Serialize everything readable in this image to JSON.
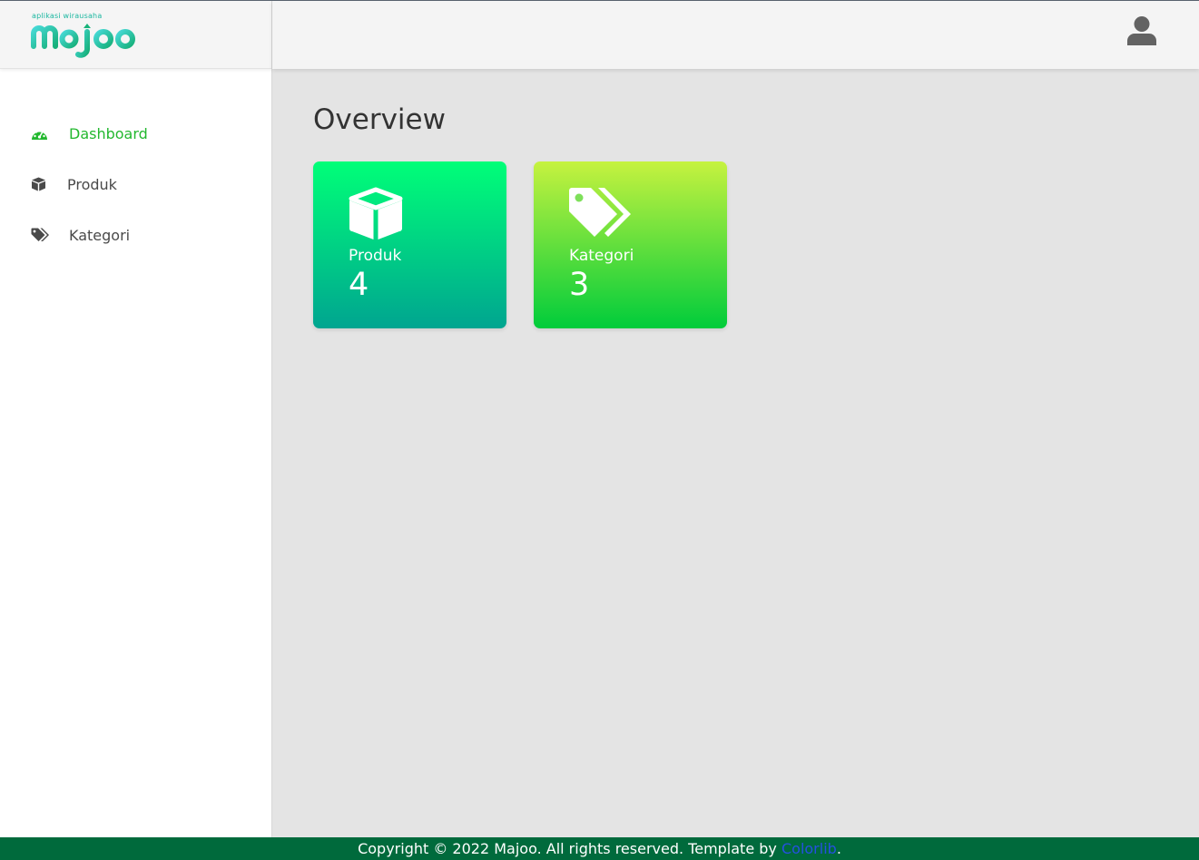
{
  "brand": {
    "tagline": "aplikasi wirausaha",
    "name": "majoo",
    "colors": {
      "logo_start": "#3fd4d0",
      "logo_end": "#19b37a"
    }
  },
  "sidebar": {
    "items": [
      {
        "label": "Dashboard",
        "icon": "dashboard-gauge-icon",
        "active": true
      },
      {
        "label": "Produk",
        "icon": "box-cube-icon",
        "active": false
      },
      {
        "label": "Kategori",
        "icon": "tags-icon",
        "active": false
      }
    ],
    "active_color": "#23b82f"
  },
  "header": {
    "user_icon": "user-avatar-icon"
  },
  "main": {
    "title": "Overview",
    "cards": [
      {
        "label": "Produk",
        "value": "4",
        "icon": "box-cube-icon",
        "gradient": [
          "#00ff78",
          "#00a590"
        ]
      },
      {
        "label": "Kategori",
        "value": "3",
        "icon": "tags-icon",
        "gradient": [
          "#c6f23f",
          "#00cc3b"
        ]
      }
    ]
  },
  "footer": {
    "text": "Copyright © 2022 Majoo. All rights reserved. Template by ",
    "link_text": "Colorlib",
    "suffix": ".",
    "background": "#006a3c"
  }
}
